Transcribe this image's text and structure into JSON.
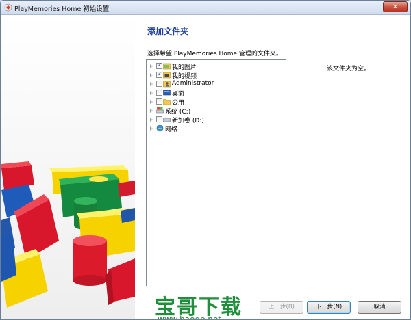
{
  "window": {
    "title": "PlayMemories Home 初始设置",
    "close_label": "✕"
  },
  "main": {
    "heading": "添加文件夹",
    "prompt": "选择希望 PlayMemories Home 管理的文件夹。",
    "status_text": "该文件夹为空。"
  },
  "tree": {
    "items": [
      {
        "label": "我的图片",
        "checked": true,
        "icon": "pictures-folder-icon",
        "has_checkbox": true
      },
      {
        "label": "我的视频",
        "checked": true,
        "icon": "videos-folder-icon",
        "has_checkbox": true
      },
      {
        "label": "Administrator",
        "checked": false,
        "icon": "user-folder-icon",
        "has_checkbox": true
      },
      {
        "label": "桌面",
        "checked": false,
        "icon": "desktop-icon",
        "has_checkbox": true
      },
      {
        "label": "公用",
        "checked": false,
        "icon": "folder-icon",
        "has_checkbox": true
      },
      {
        "label": "系统 (C:)",
        "checked": false,
        "icon": "system-drive-icon",
        "has_checkbox": false
      },
      {
        "label": "新加卷 (D:)",
        "checked": false,
        "icon": "drive-icon",
        "has_checkbox": true
      },
      {
        "label": "网络",
        "checked": false,
        "icon": "network-icon",
        "has_checkbox": false
      }
    ]
  },
  "buttons": {
    "back_label": "上一步(B)",
    "next_label": "下一步(N)",
    "cancel_label": "取消"
  },
  "watermark": {
    "text": "宝哥下载",
    "url": "www.baoge.net"
  }
}
